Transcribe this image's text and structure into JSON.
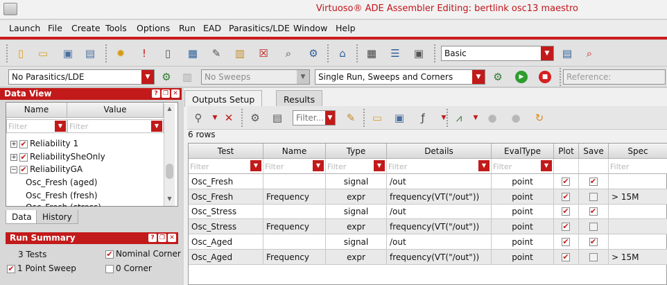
{
  "window": {
    "title": "Virtuoso® ADE Assembler Editing: bertlink osc13 maestro"
  },
  "menu": [
    "Launch",
    "File",
    "Create",
    "Tools",
    "Options",
    "Run",
    "EAD",
    "Parasitics/LDE",
    "Window",
    "Help"
  ],
  "toolbar": {
    "mode_combo": "Basic"
  },
  "toolbar2": {
    "parasitics_combo": "No Parasitics/LDE",
    "sweeps_combo": "No Sweeps",
    "run_mode_combo": "Single Run, Sweeps and Corners",
    "reference_placeholder": "Reference:"
  },
  "data_view": {
    "title": "Data View",
    "col_name": "Name",
    "col_value": "Value",
    "filter_placeholder": "Filter",
    "items": [
      {
        "label": "Reliability 1",
        "expander": "+",
        "checked": true
      },
      {
        "label": "ReliabilitySheOnly",
        "expander": "+",
        "checked": true
      },
      {
        "label": "ReliabilityGA",
        "expander": "−",
        "checked": true
      },
      {
        "label": "Osc_Fresh (aged)"
      },
      {
        "label": "Osc_Fresh (fresh)"
      },
      {
        "label": "Osc_Fresh (stress)"
      }
    ],
    "tabs": [
      "Data",
      "History"
    ]
  },
  "run_summary": {
    "title": "Run Summary",
    "tests": "3 Tests",
    "nominal_corner": "Nominal Corner",
    "point_sweep": "1 Point Sweep",
    "corner": "0 Corner"
  },
  "outputs": {
    "tabs": [
      "Outputs Setup",
      "Results"
    ],
    "filter_placeholder": "Filter...",
    "row_count": "6 rows",
    "columns": [
      "Test",
      "Name",
      "Type",
      "Details",
      "EvalType",
      "Plot",
      "Save",
      "Spec"
    ],
    "filter_text": "Filter",
    "rows": [
      {
        "test": "Osc_Fresh",
        "name": "",
        "type": "signal",
        "details": "/out",
        "evaltype": "point",
        "plot": true,
        "save": true,
        "spec": ""
      },
      {
        "test": "Osc_Fresh",
        "name": "Frequency",
        "type": "expr",
        "details": "frequency(VT(\"/out\"))",
        "evaltype": "point",
        "plot": true,
        "save": false,
        "spec": "> 15M"
      },
      {
        "test": "Osc_Stress",
        "name": "",
        "type": "signal",
        "details": "/out",
        "evaltype": "point",
        "plot": true,
        "save": true,
        "spec": ""
      },
      {
        "test": "Osc_Stress",
        "name": "Frequency",
        "type": "expr",
        "details": "frequency(VT(\"/out\"))",
        "evaltype": "point",
        "plot": true,
        "save": false,
        "spec": ""
      },
      {
        "test": "Osc_Aged",
        "name": "",
        "type": "signal",
        "details": "/out",
        "evaltype": "point",
        "plot": true,
        "save": true,
        "spec": ""
      },
      {
        "test": "Osc_Aged",
        "name": "Frequency",
        "type": "expr",
        "details": "frequency(VT(\"/out\"))",
        "evaltype": "point",
        "plot": true,
        "save": false,
        "spec": "> 15M"
      }
    ]
  },
  "colors": {
    "accent": "#c21a1a",
    "title_text": "#c0141a",
    "run_green": "#2e9c2e",
    "stop_red": "#d42020"
  },
  "icons": [
    "new-icon",
    "open-icon",
    "save-icon",
    "print-icon",
    "gear-icon",
    "thermometer-icon",
    "document-icon",
    "network-icon",
    "edit-icon",
    "scroll-icon",
    "checklist-icon",
    "inspect-icon",
    "settings-icon",
    "home-icon",
    "calculator-icon",
    "panel-icon",
    "window-icon"
  ]
}
